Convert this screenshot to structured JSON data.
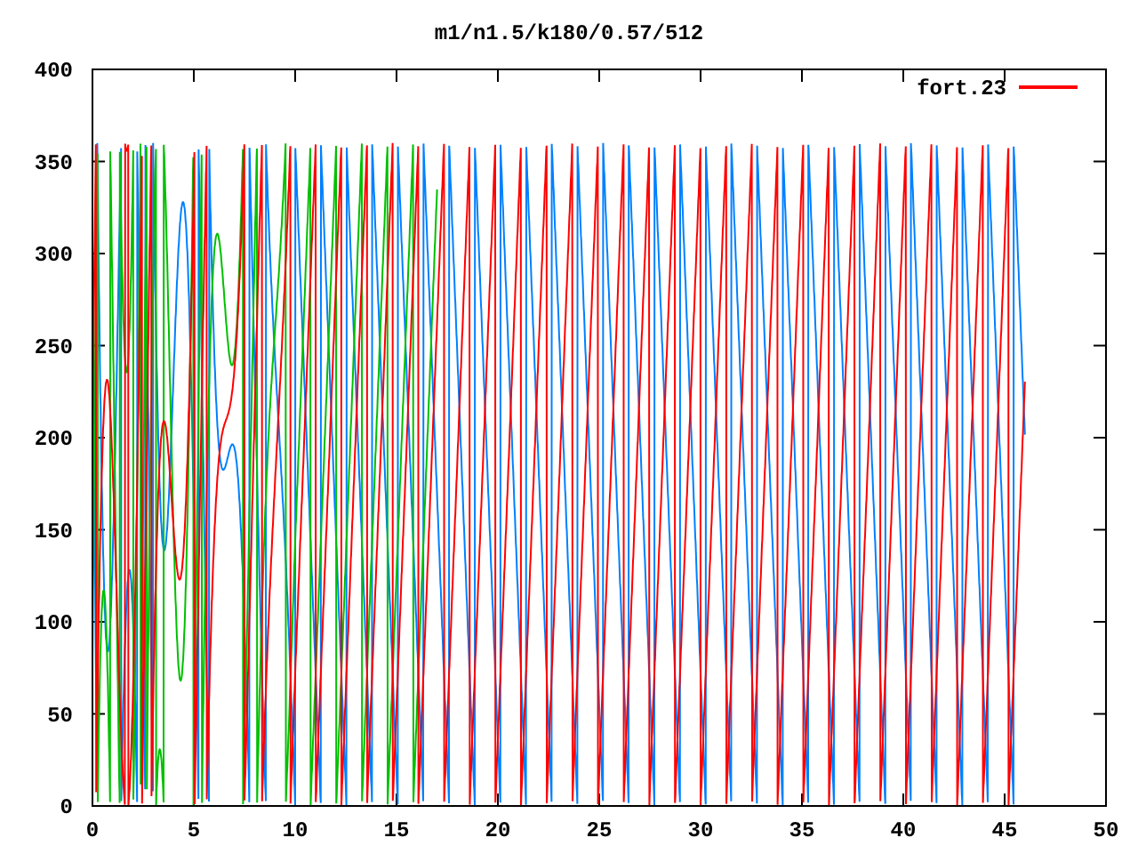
{
  "title": "m1/n1.5/k180/0.57/512",
  "y_ticks": [
    "400",
    "350",
    "300",
    "250",
    "200",
    "150",
    "100",
    "50",
    "0"
  ],
  "x_ticks": [
    "0",
    "5",
    "10",
    "15",
    "20",
    "25",
    "30",
    "35",
    "40",
    "45",
    "50"
  ],
  "legend": [
    {
      "label": "fort.23",
      "color": "#ff0000"
    }
  ]
}
